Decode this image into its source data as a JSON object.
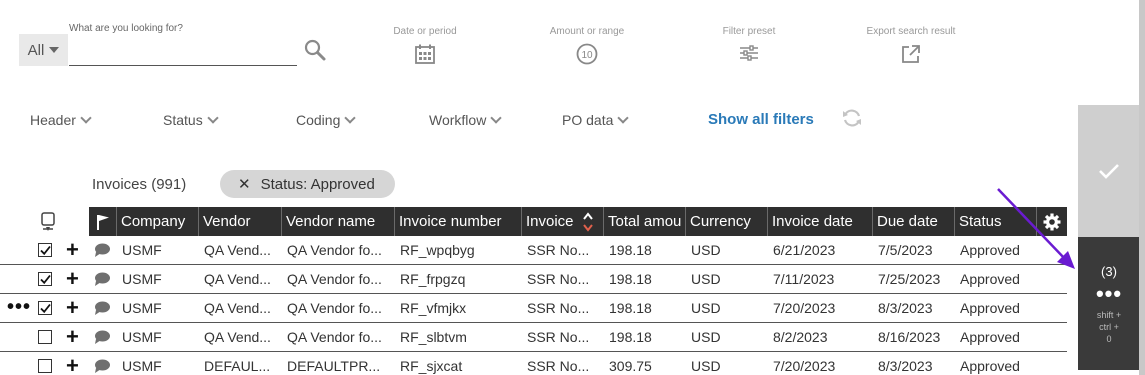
{
  "search": {
    "scope_value": "All",
    "label": "What are you looking for?",
    "value": "",
    "placeholder": ""
  },
  "tools": {
    "date_label": "Date or period",
    "amount_label": "Amount or range",
    "amount_icon_text": "10",
    "preset_label": "Filter preset",
    "export_label": "Export search result"
  },
  "filters": {
    "items": [
      {
        "label": "Header"
      },
      {
        "label": "Status"
      },
      {
        "label": "Coding"
      },
      {
        "label": "Workflow"
      },
      {
        "label": "PO data"
      }
    ],
    "show_all_label": "Show all filters"
  },
  "invoices": {
    "count_label": "Invoices (991)",
    "chip_label": "Status: Approved"
  },
  "table": {
    "columns": [
      "Company",
      "Vendor",
      "Vendor name",
      "Invoice number",
      "Invoice",
      "Total amou",
      "Currency",
      "Invoice date",
      "Due date",
      "Status"
    ],
    "rows": [
      {
        "checked": true,
        "company": "USMF",
        "vendor": "QA Vend...",
        "vendor_name": "QA Vendor fo...",
        "invoice_number": "RF_wpqbyg",
        "invoice": "SSR No...",
        "total": "198.18",
        "currency": "USD",
        "invoice_date": "6/21/2023",
        "due_date": "7/5/2023",
        "status": "Approved"
      },
      {
        "checked": true,
        "company": "USMF",
        "vendor": "QA Vend...",
        "vendor_name": "QA Vendor fo...",
        "invoice_number": "RF_frpgzq",
        "invoice": "SSR No...",
        "total": "198.18",
        "currency": "USD",
        "invoice_date": "7/11/2023",
        "due_date": "7/25/2023",
        "status": "Approved"
      },
      {
        "checked": true,
        "company": "USMF",
        "vendor": "QA Vend...",
        "vendor_name": "QA Vendor fo...",
        "invoice_number": "RF_vfmjkx",
        "invoice": "SSR No...",
        "total": "198.18",
        "currency": "USD",
        "invoice_date": "7/20/2023",
        "due_date": "8/3/2023",
        "status": "Approved"
      },
      {
        "checked": false,
        "company": "USMF",
        "vendor": "QA Vend...",
        "vendor_name": "QA Vendor fo...",
        "invoice_number": "RF_slbtvm",
        "invoice": "SSR No...",
        "total": "198.18",
        "currency": "USD",
        "invoice_date": "8/2/2023",
        "due_date": "8/16/2023",
        "status": "Approved"
      },
      {
        "checked": false,
        "company": "USMF",
        "vendor": "DEFAUL...",
        "vendor_name": "DEFAULTPR...",
        "invoice_number": "RF_sjxcat",
        "invoice": "SSR No...",
        "total": "309.75",
        "currency": "USD",
        "invoice_date": "7/20/2023",
        "due_date": "8/3/2023",
        "status": "Approved"
      }
    ]
  },
  "side_panel": {
    "count": "(3)",
    "dots": "•••",
    "shortcut": "shift +\nctrl +\n0"
  },
  "row_more": "•••",
  "colors": {
    "header_bg": "#2f2f2f",
    "link_blue": "#2a7ab8",
    "annotation_arrow": "#6a1bd1",
    "approve_panel_bg": "#cfcfcf",
    "actions_panel_bg": "#3a3a3a"
  }
}
